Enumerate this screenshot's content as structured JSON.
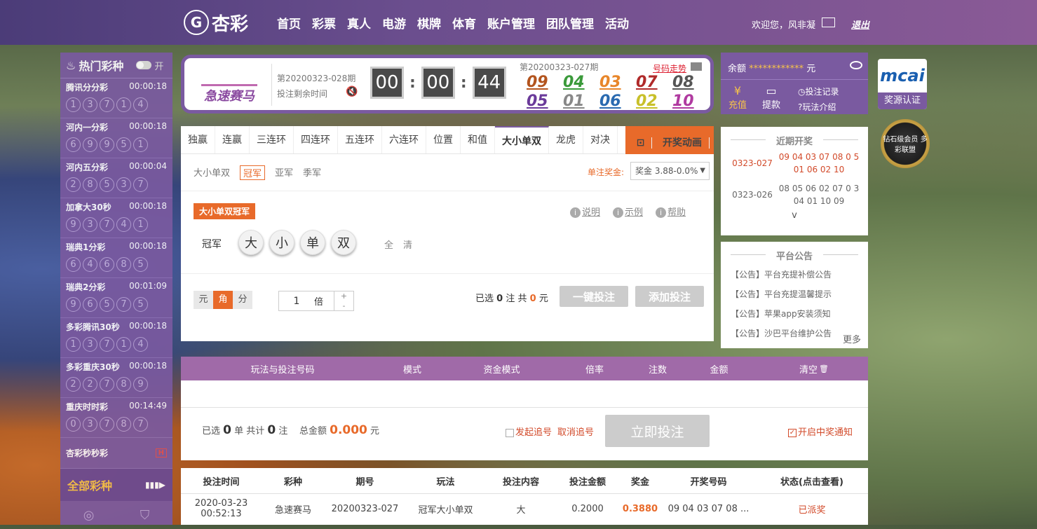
{
  "header": {
    "brand": "杏彩",
    "brand_mark": "G",
    "nav": [
      "首页",
      "彩票",
      "真人",
      "电游",
      "棋牌",
      "体育",
      "账户管理",
      "团队管理",
      "活动"
    ],
    "welcome": "欢迎您，风非凝",
    "logout": "退出"
  },
  "sidebar": {
    "title": "热门彩种",
    "toggle_label": "开",
    "lotteries": [
      {
        "name": "腾讯分分彩",
        "time": "00:00:18",
        "balls": [
          "1",
          "3",
          "7",
          "1",
          "4"
        ]
      },
      {
        "name": "河内一分彩",
        "time": "00:00:18",
        "balls": [
          "6",
          "9",
          "9",
          "5",
          "1"
        ]
      },
      {
        "name": "河内五分彩",
        "time": "00:00:04",
        "balls": [
          "2",
          "8",
          "5",
          "3",
          "7"
        ]
      },
      {
        "name": "加拿大30秒",
        "time": "00:00:18",
        "balls": [
          "9",
          "3",
          "7",
          "4",
          "1"
        ]
      },
      {
        "name": "瑞典1分彩",
        "time": "00:00:18",
        "balls": [
          "6",
          "4",
          "6",
          "8",
          "5"
        ]
      },
      {
        "name": "瑞典2分彩",
        "time": "00:01:09",
        "balls": [
          "9",
          "6",
          "5",
          "7",
          "5"
        ]
      },
      {
        "name": "多彩腾讯30秒",
        "time": "00:00:18",
        "balls": [
          "1",
          "3",
          "7",
          "1",
          "4"
        ]
      },
      {
        "name": "多彩重庆30秒",
        "time": "00:00:18",
        "balls": [
          "2",
          "2",
          "7",
          "8",
          "9"
        ]
      },
      {
        "name": "重庆时时彩",
        "time": "00:14:49",
        "balls": [
          "0",
          "3",
          "7",
          "8",
          "7"
        ]
      }
    ],
    "miaomiao": "杏彩秒秒彩",
    "miaomiao_badge": "H",
    "all_games": "全部彩种",
    "all_games_arrow": "▮▮▮▶"
  },
  "game": {
    "logo_text": "急速赛马",
    "current_issue": "第20200323-028期",
    "countdown_label": "投注剩余时间",
    "timer": [
      "00",
      "00",
      "44"
    ],
    "last_issue": "第20200323-027期",
    "trend_link": "号码走势",
    "last_numbers": [
      {
        "n": "09",
        "c": "#b3541e"
      },
      {
        "n": "04",
        "c": "#3a9a3a"
      },
      {
        "n": "03",
        "c": "#e8862a"
      },
      {
        "n": "07",
        "c": "#b02a2a"
      },
      {
        "n": "08",
        "c": "#555555"
      },
      {
        "n": "05",
        "c": "#6a3a9a"
      },
      {
        "n": "01",
        "c": "#888888"
      },
      {
        "n": "06",
        "c": "#2a6ab0"
      },
      {
        "n": "02",
        "c": "#c8c02a"
      },
      {
        "n": "10",
        "c": "#b03aa0"
      }
    ]
  },
  "tabs": [
    "独赢",
    "连赢",
    "三连环",
    "四连环",
    "五连环",
    "六连环",
    "位置",
    "和值",
    "大小单双",
    "龙虎",
    "对决"
  ],
  "tab_active": "大小单双",
  "open_animation": "开奖动画",
  "subtabs": [
    "大小单双",
    "冠军",
    "亚军",
    "季军"
  ],
  "subtab_active": "冠军",
  "prize_label": "单注奖金:",
  "prize_select": "奖金 3.88-0.0%",
  "play_tag": "大小单双冠军",
  "help_links": [
    "说明",
    "示例",
    "帮助"
  ],
  "row_label": "冠军",
  "options": [
    "大",
    "小",
    "单",
    "双"
  ],
  "quick_select": [
    "全",
    "清"
  ],
  "units": [
    "元",
    "角",
    "分"
  ],
  "unit_active": "角",
  "multiplier": "1",
  "multiplier_unit": "倍",
  "selection": {
    "prefix": "已选",
    "count": "0",
    "mid": "注  共",
    "amount": "0",
    "suffix": "元"
  },
  "one_click": "一键投注",
  "add_bet": "添加投注",
  "balance": {
    "label": "余额",
    "masked": "************",
    "unit": "元",
    "recharge": "充值",
    "withdraw": "提款",
    "bet_records": "投注记录",
    "play_intro": "玩法介绍"
  },
  "recent": {
    "title": "近期开奖",
    "rows": [
      {
        "issue": "0323-027",
        "nums": "09 04 03 07 08 0 5 01 06 02 10"
      },
      {
        "issue": "0323-026",
        "nums": "08 05 06 02 07 0 3 04 01 10 09"
      }
    ],
    "expand": "v"
  },
  "notice": {
    "title": "平台公告",
    "items": [
      "【公告】平台充提补偿公告",
      "【公告】平台充提温馨提示",
      "【公告】苹果app安装须知",
      "【公告】沙巴平台维护公告"
    ],
    "more": "更多"
  },
  "cert": {
    "logo": "mcai",
    "label": "奖源认证",
    "medal": "钻石级会员 多彩联盟"
  },
  "cart": {
    "headers": [
      "玩法与投注号码",
      "模式",
      "资金模式",
      "倍率",
      "注数",
      "金额",
      "清空"
    ],
    "selected": "已选",
    "sel_count": "0",
    "unit_dan": "单 共计",
    "total_count": "0",
    "unit_zhu": "注",
    "total_label": "总金额",
    "total_amount": "0.000",
    "yuan": "元",
    "chase": "发起追号",
    "cancel_chase": "取消追号",
    "bet_now": "立即投注",
    "notify": "开启中奖通知"
  },
  "history": {
    "headers": [
      "投注时间",
      "彩种",
      "期号",
      "玩法",
      "投注内容",
      "投注金额",
      "奖金",
      "开奖号码",
      "状态(点击查看)"
    ],
    "rows": [
      [
        "2020-03-23 00:52:13",
        "急速赛马",
        "20200323-027",
        "冠军大小单双",
        "大",
        "0.2000",
        "0.3880",
        "09 04 03 07 08 ...",
        "已派奖"
      ]
    ]
  },
  "colors": {
    "accent": "#e86a2a",
    "purple": "#7a5aa0",
    "red": "#d24a2a"
  }
}
